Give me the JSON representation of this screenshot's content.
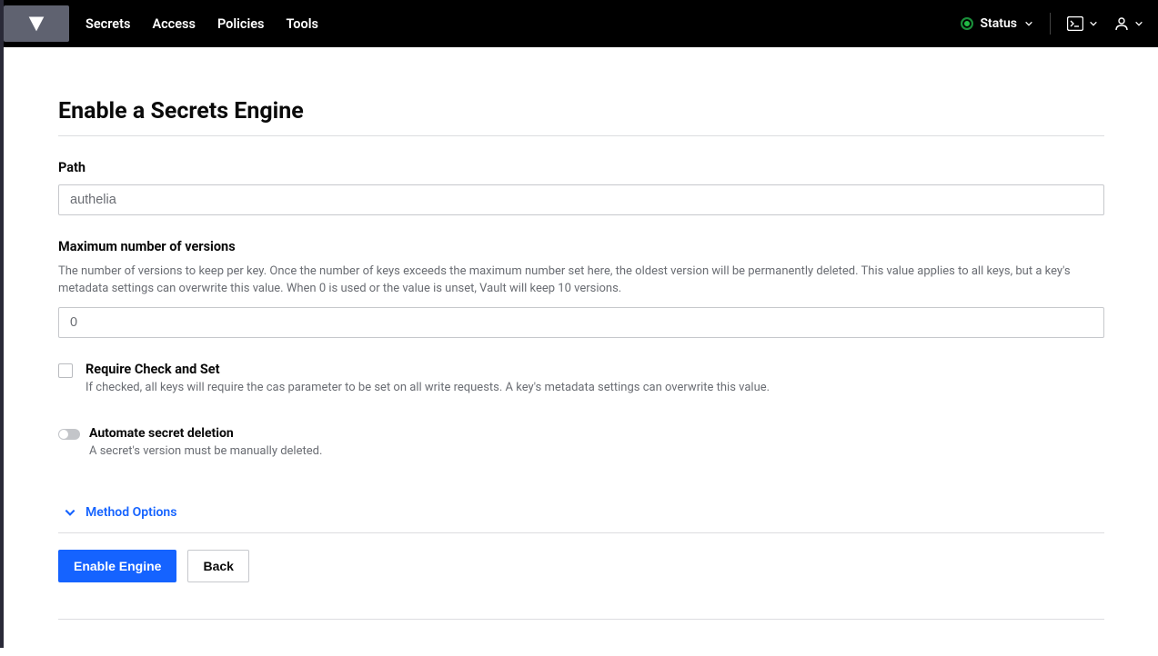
{
  "nav": {
    "items": [
      "Secrets",
      "Access",
      "Policies",
      "Tools"
    ],
    "status_label": "Status"
  },
  "page": {
    "title": "Enable a Secrets Engine"
  },
  "form": {
    "path": {
      "label": "Path",
      "value": "authelia"
    },
    "max_versions": {
      "label": "Maximum number of versions",
      "help": "The number of versions to keep per key. Once the number of keys exceeds the maximum number set here, the oldest version will be permanently deleted. This value applies to all keys, but a key's metadata settings can overwrite this value. When 0 is used or the value is unset, Vault will keep 10 versions.",
      "value": "0"
    },
    "require_cas": {
      "label": "Require Check and Set",
      "help": "If checked, all keys will require the cas parameter to be set on all write requests. A key's metadata settings can overwrite this value."
    },
    "auto_delete": {
      "label": "Automate secret deletion",
      "help": "A secret's version must be manually deleted."
    },
    "method_options": "Method Options"
  },
  "actions": {
    "submit": "Enable Engine",
    "back": "Back"
  }
}
